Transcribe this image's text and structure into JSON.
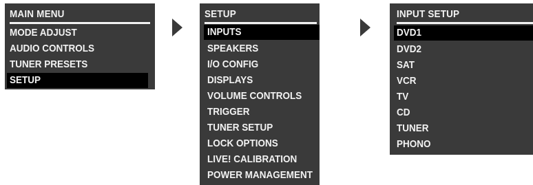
{
  "main_menu": {
    "title": "MAIN MENU",
    "items": [
      {
        "label": "MODE ADJUST"
      },
      {
        "label": "AUDIO CONTROLS"
      },
      {
        "label": "TUNER PRESETS"
      },
      {
        "label": "SETUP",
        "selected": true
      }
    ]
  },
  "setup_menu": {
    "title": "SETUP",
    "items": [
      {
        "label": "INPUTS",
        "selected": true
      },
      {
        "label": "SPEAKERS"
      },
      {
        "label": "I/O CONFIG"
      },
      {
        "label": "DISPLAYS"
      },
      {
        "label": "VOLUME CONTROLS"
      },
      {
        "label": "TRIGGER"
      },
      {
        "label": "TUNER SETUP"
      },
      {
        "label": "LOCK OPTIONS"
      },
      {
        "label": "LIVE! CALIBRATION"
      },
      {
        "label": "POWER MANAGEMENT"
      }
    ]
  },
  "input_setup_menu": {
    "title": "INPUT SETUP",
    "items": [
      {
        "label": "DVD1",
        "selected": true
      },
      {
        "label": "DVD2"
      },
      {
        "label": "SAT"
      },
      {
        "label": "VCR"
      },
      {
        "label": "TV"
      },
      {
        "label": "CD"
      },
      {
        "label": "TUNER"
      },
      {
        "label": "PHONO"
      }
    ]
  },
  "icons": {
    "arrow_1": "triangle-right-icon",
    "arrow_2": "triangle-right-icon"
  },
  "colors": {
    "panel_bg": "#3a3a3a",
    "text": "#f2f2f2",
    "selection_bg": "#000000"
  }
}
